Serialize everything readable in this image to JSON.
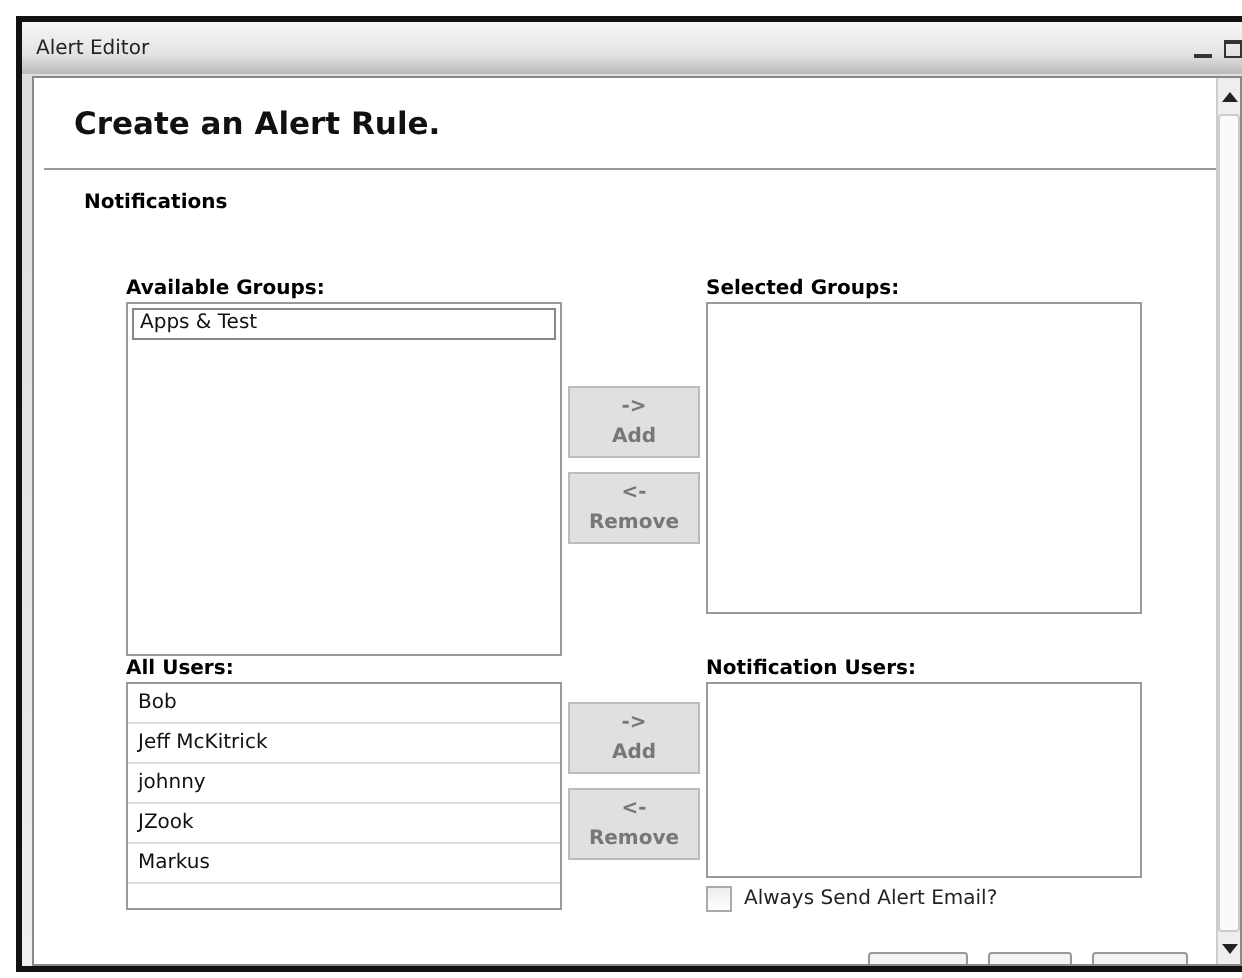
{
  "window": {
    "title": "Alert Editor"
  },
  "heading": "Create an Alert Rule.",
  "section": "Notifications",
  "groups": {
    "available_label": "Available Groups:",
    "available": [
      {
        "label": "Apps & Test",
        "selected": true
      }
    ],
    "selected_label": "Selected Groups:",
    "add": {
      "arrow": "->",
      "label": "Add",
      "disabled": true
    },
    "remove": {
      "arrow": "<-",
      "label": "Remove",
      "disabled": true
    }
  },
  "users": {
    "available_label": "All Users:",
    "available": [
      {
        "label": "Bob",
        "selected": false
      },
      {
        "label": "Jeff McKitrick",
        "selected": false
      },
      {
        "label": "johnny",
        "selected": false
      },
      {
        "label": "JZook",
        "selected": false
      },
      {
        "label": "Markus",
        "selected": false
      }
    ],
    "selected_label": "Notification Users:",
    "add": {
      "arrow": "->",
      "label": "Add",
      "disabled": true
    },
    "remove": {
      "arrow": "<-",
      "label": "Remove",
      "disabled": true
    }
  },
  "always_email": {
    "label": "Always Send Alert Email?",
    "checked": false
  }
}
